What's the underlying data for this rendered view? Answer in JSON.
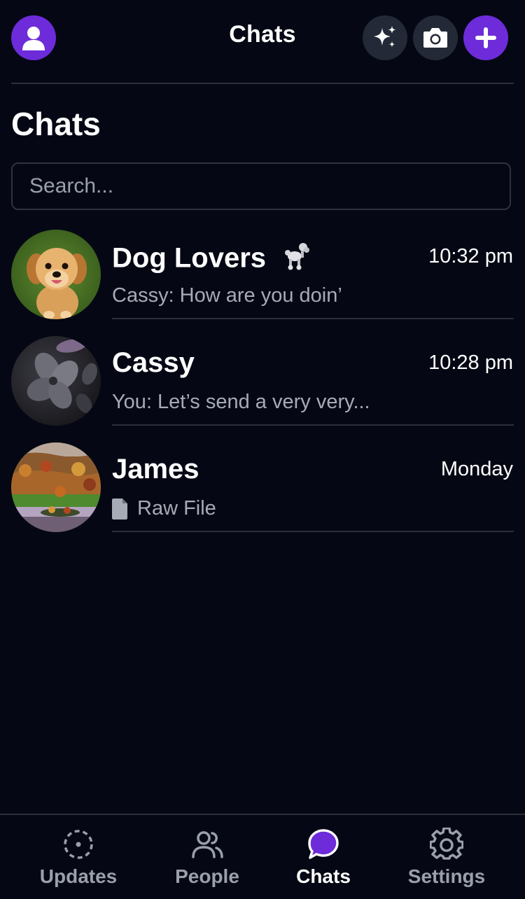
{
  "header": {
    "title": "Chats",
    "profile_icon": "user-icon",
    "actions": [
      {
        "name": "sparkle-button",
        "icon": "sparkle-icon"
      },
      {
        "name": "camera-button",
        "icon": "camera-icon"
      },
      {
        "name": "new-chat-button",
        "icon": "plus-icon"
      }
    ]
  },
  "main": {
    "section_title": "Chats",
    "search": {
      "placeholder": "Search...",
      "value": ""
    }
  },
  "chats": [
    {
      "name": "Dog Lovers",
      "emoji_icon": "poodle-icon",
      "time": "10:32 pm",
      "preview": "Cassy: How are you doin’",
      "avatar": "golden-retriever-puppy-photo"
    },
    {
      "name": "Cassy",
      "time": "10:28 pm",
      "preview": "You: Let’s send a very very...",
      "avatar": "dark-flower-photo"
    },
    {
      "name": "James",
      "time": "Monday",
      "preview": "Raw File",
      "preview_icon": "file-icon",
      "avatar": "autumn-landscape-photo"
    }
  ],
  "bottom_nav": {
    "items": [
      {
        "label": "Updates",
        "icon": "updates-icon",
        "active": false
      },
      {
        "label": "People",
        "icon": "people-icon",
        "active": false
      },
      {
        "label": "Chats",
        "icon": "chat-bubble-icon",
        "active": true
      },
      {
        "label": "Settings",
        "icon": "gear-icon",
        "active": false
      }
    ]
  },
  "colors": {
    "background": "#050814",
    "accent": "#6d2bd9",
    "secondary_text": "#a6abb6",
    "divider": "#2a2f3a"
  }
}
